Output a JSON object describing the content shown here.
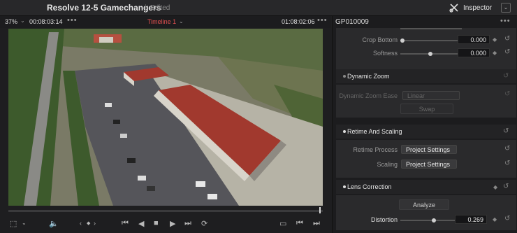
{
  "titlebar": {
    "project": "Resolve 12-5 Gamechangers",
    "status": "Edited",
    "inspector_label": "Inspector"
  },
  "viewer": {
    "zoom": "37%",
    "source_tc": "00:08:03:14",
    "timeline": "Timeline 1",
    "record_tc": "01:08:02:06",
    "more": "•••",
    "scrub_position": 0.99
  },
  "inspector": {
    "clip": "GP010009",
    "more": "•••",
    "crop_bottom": {
      "label": "Crop Bottom",
      "value": "0.000"
    },
    "softness": {
      "label": "Softness",
      "value": "0.000"
    },
    "dynamic_zoom": {
      "title": "Dynamic Zoom",
      "ease_label": "Dynamic Zoom Ease",
      "ease_value": "Linear",
      "swap_label": "Swap"
    },
    "retime": {
      "title": "Retime And Scaling",
      "process_label": "Retime Process",
      "process_value": "Project Settings",
      "scaling_label": "Scaling",
      "scaling_value": "Project Settings"
    },
    "lens": {
      "title": "Lens Correction",
      "analyze_label": "Analyze",
      "distortion_label": "Distortion",
      "distortion_value": "0.269"
    }
  },
  "icons": [
    "scissors-icon",
    "expand-icon",
    "dropdown-icon",
    "speaker-icon",
    "prev-frame-icon",
    "next-frame-icon",
    "jump-start-icon",
    "step-back-icon",
    "stop-icon",
    "play-icon",
    "jump-end-icon",
    "loop-icon",
    "safe-area-icon",
    "previous-clip-icon",
    "next-clip-icon",
    "keyframe-icon",
    "reset-icon"
  ]
}
